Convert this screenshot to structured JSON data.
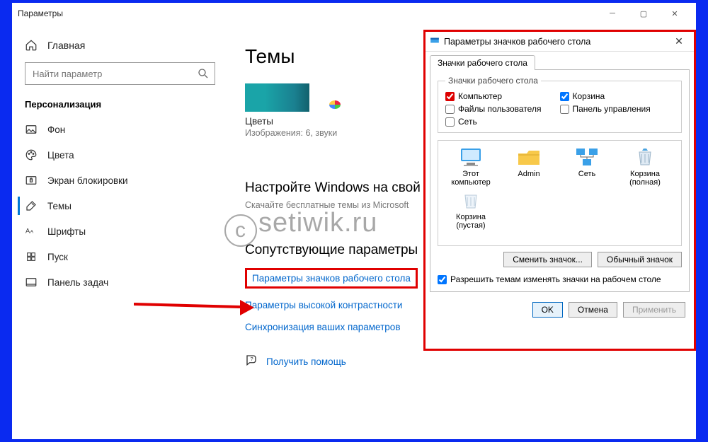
{
  "window": {
    "title": "Параметры"
  },
  "sidebar": {
    "home": "Главная",
    "search_placeholder": "Найти параметр",
    "section": "Персонализация",
    "items": [
      {
        "label": "Фон"
      },
      {
        "label": "Цвета"
      },
      {
        "label": "Экран блокировки"
      },
      {
        "label": "Темы"
      },
      {
        "label": "Шрифты"
      },
      {
        "label": "Пуск"
      },
      {
        "label": "Панель задач"
      }
    ]
  },
  "main": {
    "heading": "Темы",
    "theme_name": "Цветы",
    "theme_sub": "Изображения: 6, звуки",
    "customize_head": "Настройте Windows на свой",
    "customize_sub": "Скачайте бесплатные темы из Microsoft",
    "related_head": "Сопутствующие параметры",
    "link1": "Параметры значков рабочего стола",
    "link2": "Параметры высокой контрастности",
    "link3": "Синхронизация ваших параметров",
    "help": "Получить помощь"
  },
  "watermark": "setiwik.ru",
  "dialog": {
    "title": "Параметры значков рабочего стола",
    "tab": "Значки рабочего стола",
    "group": "Значки рабочего стола",
    "checks": {
      "computer": "Компьютер",
      "recycle": "Корзина",
      "userfiles": "Файлы пользователя",
      "cpanel": "Панель управления",
      "network": "Сеть"
    },
    "icons": {
      "thispc": "Этот компьютер",
      "admin": "Admin",
      "net": "Сеть",
      "bin_full": "Корзина (полная)",
      "bin_empty": "Корзина (пустая)"
    },
    "btn_change": "Сменить значок...",
    "btn_default": "Обычный значок",
    "allow": "Разрешить темам изменять значки на рабочем столе",
    "ok": "OK",
    "cancel": "Отмена",
    "apply": "Применить"
  }
}
